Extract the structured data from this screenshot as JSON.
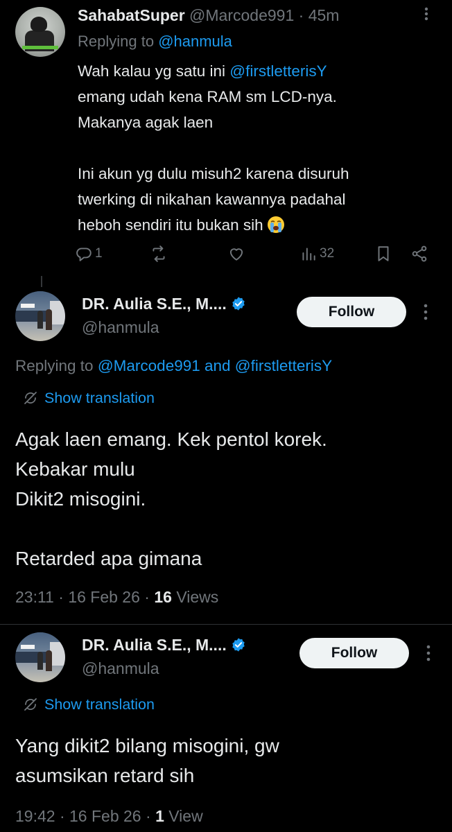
{
  "reply_tweet": {
    "name": "SahabatSuper",
    "handle": "@Marcode991",
    "time": " · 45m",
    "replying_prefix": "Replying to ",
    "replying_to": "@hanmula",
    "text_1": "Wah kalau yg satu ini ",
    "mention": "@firstletterisY",
    "text_2": "\nemang udah kena RAM sm LCD-nya.\nMakanya agak laen\n\nIni akun yg dulu misuh2 karena disuruh\ntwerking di nikahan kawannya padahal\nheboh sendiri itu bukan sih",
    "emoji": "loudly-crying-face",
    "reply_count": "1",
    "views_count": "32"
  },
  "main_tweet": {
    "name": "DR. Aulia S.E., M....",
    "handle": "@hanmula",
    "follow_label": "Follow",
    "replying_prefix": "Replying to ",
    "replying_to_1": "@Marcode991",
    "replying_and": " and ",
    "replying_to_2": "@firstletterisY",
    "translate_label": "Show translation",
    "text": "Agak laen emang. Kek pentol korek.\nKebakar mulu\nDikit2 misogini.\n\nRetarded apa gimana",
    "time": "23:11",
    "date": "16 Feb 26",
    "views_count": "16",
    "views_label": "Views"
  },
  "main_tweet_2": {
    "name": "DR. Aulia S.E., M....",
    "handle": "@hanmula",
    "follow_label": "Follow",
    "translate_label": "Show translation",
    "text": "Yang dikit2 bilang misogini, gw\nasumsikan retard sih",
    "time": "19:42",
    "date": "16 Feb 26",
    "views_count": "1",
    "views_label": "View"
  },
  "colors": {
    "background": "#000000",
    "text": "#e7e9ea",
    "secondary": "#71767b",
    "link": "#1d9bf0",
    "follow_bg": "#eff3f4"
  }
}
